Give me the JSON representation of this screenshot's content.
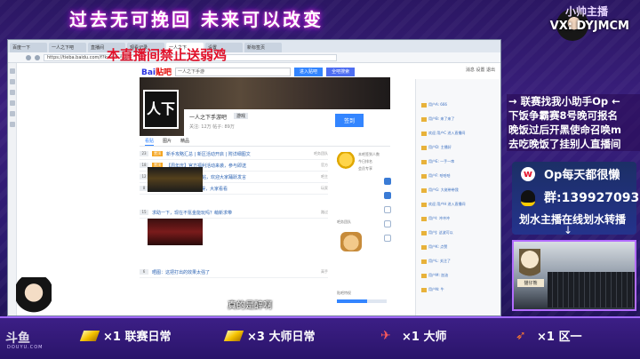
{
  "overlay": {
    "top_banner": "过去无可挽回  未来可以改变",
    "brand_title": "小帅主播",
    "brand_contact": "VX: DYJMCM",
    "no_ad_notice": "本直播间禁止送弱鸡",
    "caption": "真的是醉啊",
    "promo_lines": [
      "→ 联赛找我小助手Op ←",
      "下饭争霸赛8号晚可报名",
      "晚饭过后开黑使命召唤m",
      "去吃晚饭了挂别人直播间"
    ],
    "weibo_label": "Op每天都很懒",
    "qq_label": "群:139927093",
    "note_label": "划水主播在线划水转播",
    "down_arrow": "↓",
    "figurine_tag": "猫仔熊",
    "douyu_logo": "斗鱼",
    "douyu_sub": "DOUYU.COM"
  },
  "missions": [
    {
      "label": "×1 联赛日常",
      "icon": "gold-bar-icon"
    },
    {
      "label": "×3 大师日常",
      "icon": "gold-bar-icon"
    },
    {
      "label": "×1 大师",
      "icon": "airplane-icon"
    },
    {
      "label": "×1 区一",
      "icon": "rocket-icon"
    }
  ],
  "browser": {
    "tabs": [
      "百度一下",
      "一人之下吧",
      "直播间",
      "观看记录",
      "一人之下",
      "设置",
      "新标签页"
    ],
    "url": "https://tieba.baidu.com/f?kw=一人之下",
    "search_placeholder": "一人之下手游",
    "search_button": "进入贴吧",
    "search_button_alt": "全吧搜索",
    "top_links": "消息  设置  退出",
    "baidu_logo_blue": "Bai",
    "baidu_logo_red": "贴吧",
    "forum_badge": "人下",
    "forum_name": "一人之下手游吧",
    "forum_tag": "游戏",
    "forum_meta": "关注: 12万  帖子: 89万",
    "sign_button": "签到",
    "forum_tabs": [
      "看贴",
      "图片",
      "精品"
    ],
    "threads": [
      {
        "replies": "23",
        "top": "置顶",
        "title": "新手攻略汇总 | 新区活动开启 | 附详细图文",
        "author": "吧务团队"
      },
      {
        "replies": "18",
        "top": "置顶",
        "title": "【周年庆】官方福利活动来袭，参与即送",
        "author": "官方"
      },
      {
        "replies": "12",
        "top": "置顶",
        "title": "游戏问题反馈收集帖，欢迎大家踊跃发言",
        "author": "吧主"
      },
      {
        "replies": "8",
        "top": "",
        "title": "新一季全气运异人培养心得，大家看看",
        "author": "玩家"
      },
      {
        "replies": "15",
        "top": "",
        "title": "求助一下，现在不氪金能玩吗？萌新求带",
        "author": "路过"
      },
      {
        "replies": "6",
        "top": "",
        "title": "晒图：这把打出的效果太强了",
        "author": "高手"
      }
    ],
    "sidebar_lines": [
      "本吧签到人数",
      "今日排名",
      "会员专享",
      "吧务团队",
      "贴吧特权"
    ],
    "chat_rows": [
      "用户A: 666",
      "用户B: 来了来了",
      "欢迎 用户C 进入直播间",
      "用户D: 主播好",
      "用户E: 一手一串",
      "用户F: 哈哈哈",
      "用户G: 大佬带带我",
      "欢迎 用户H 进入直播间",
      "用户I: 冲冲冲",
      "用户J: 这波可以",
      "用户K: 点赞",
      "用户L: 关注了",
      "用户M: 加油",
      "用户N: 牛"
    ],
    "progress_value": 0.6
  }
}
